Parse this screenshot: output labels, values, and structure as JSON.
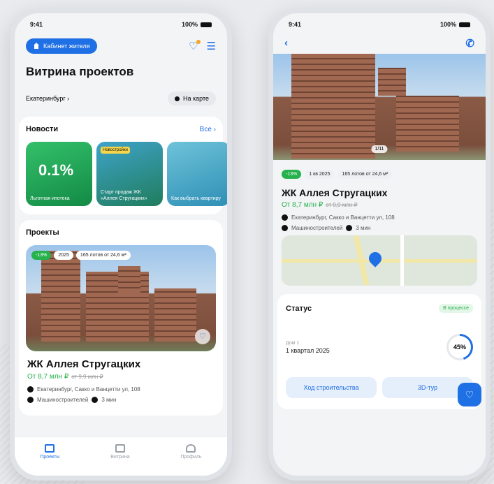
{
  "status_bar": {
    "time": "9:41",
    "battery": "100%"
  },
  "left": {
    "cabinet_button": "Кабинет жителя",
    "title": "Витрина проектов",
    "city": "Екатеринбург",
    "city_chevron": "›",
    "map_button": "На карте",
    "news": {
      "title": "Новости",
      "all_link": "Все ›",
      "stories": [
        {
          "big": "0.1%",
          "caption": "Льготная ипотека"
        },
        {
          "tag": "Новостройки",
          "caption": "Старт продаж ЖК «Аллея Стругацких»"
        },
        {
          "caption": "Как выбрать квартиру"
        }
      ]
    },
    "projects": {
      "title": "Проекты",
      "card": {
        "chips": [
          "-13%",
          "2025",
          "165 лотов от 24,6 м²"
        ],
        "name": "ЖК Аллея Стругацких",
        "price": "От 8,7 млн ₽",
        "old_price": "от 9,9 млн ₽",
        "address": "Екатеринбург, Сакко и Ванцетти ул, 108",
        "metro": "Машиностроителей",
        "walk": "3 мин"
      }
    },
    "tabs": [
      "Проекты",
      "Витрина",
      "Профиль"
    ]
  },
  "right": {
    "back": "‹",
    "call_icon": "phone-icon",
    "photo_counter": "1/11",
    "chips": [
      "-13%",
      "1 кв 2025",
      "165 лотов от 24,6 м²"
    ],
    "name": "ЖК Аллея Стругацких",
    "price": "От 8,7 млн ₽",
    "old_price": "от 9,9 млн ₽",
    "address": "Екатеринбург, Сакко и Ванцетти ул, 108",
    "metro": "Машиностроителей",
    "walk": "3 мин",
    "status": {
      "title": "Статус",
      "badge": "В процессе",
      "house": "Дом 1",
      "deadline": "1 квартал 2025",
      "progress": "45%"
    },
    "actions": {
      "construction": "Ход строительства",
      "tour": "3D-тур"
    }
  },
  "colors": {
    "accent": "#1f6fe5",
    "green": "#25b14c"
  }
}
